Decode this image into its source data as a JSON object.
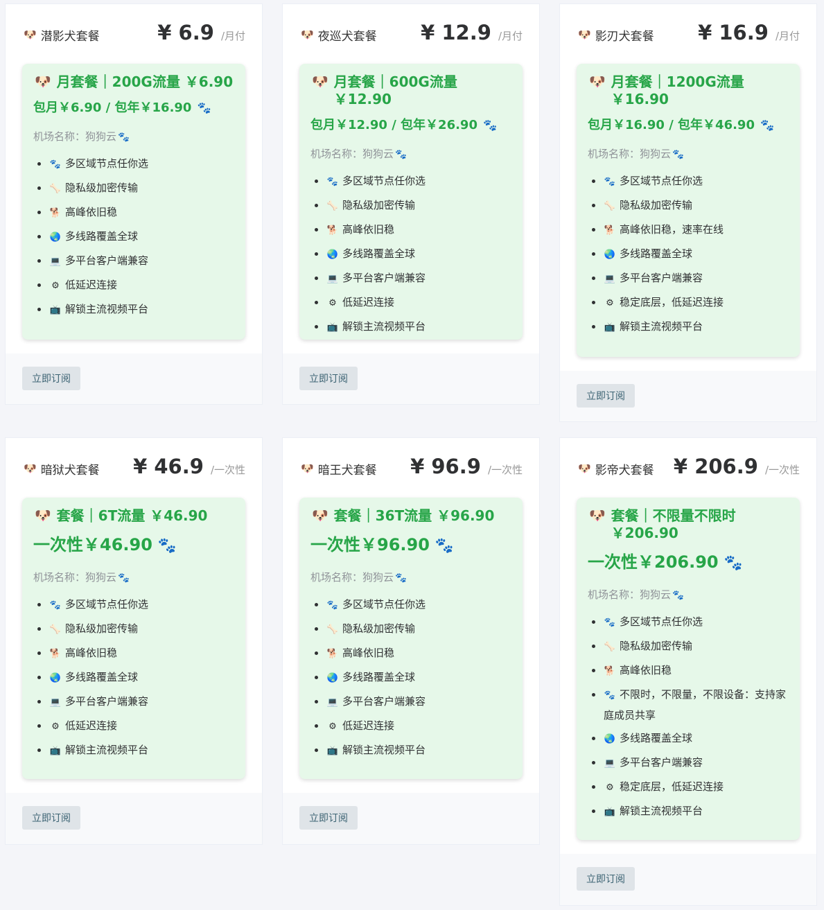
{
  "subscribe_label": "立即订阅",
  "airport_label": "机场名称：狗狗云",
  "cards": [
    {
      "title": "潜影犬套餐",
      "price": "¥ 6.9",
      "unit": "/月付",
      "inner_title": "月套餐｜200G流量 ￥6.90",
      "price_line": "包月￥6.90 / 包年￥16.90",
      "features": [
        "多区域节点任你选",
        "隐私级加密传输",
        "高峰依旧稳",
        "多线路覆盖全球",
        "多平台客户端兼容",
        "低延迟连接",
        "解锁主流视频平台"
      ]
    },
    {
      "title": "夜巡犬套餐",
      "price": "¥ 12.9",
      "unit": "/月付",
      "inner_title": "月套餐｜600G流量 ￥12.90",
      "price_line": "包月￥12.90 / 包年￥26.90",
      "features": [
        "多区域节点任你选",
        "隐私级加密传输",
        "高峰依旧稳",
        "多线路覆盖全球",
        "多平台客户端兼容",
        "低延迟连接",
        "解锁主流视频平台"
      ]
    },
    {
      "title": "影刃犬套餐",
      "price": "¥ 16.9",
      "unit": "/月付",
      "inner_title": "月套餐｜1200G流量 ￥16.90",
      "price_line": "包月￥16.90 / 包年￥46.90",
      "features": [
        "多区域节点任你选",
        "隐私级加密传输",
        "高峰依旧稳，速率在线",
        "多线路覆盖全球",
        "多平台客户端兼容",
        "稳定底层，低延迟连接",
        "解锁主流视频平台"
      ]
    },
    {
      "title": "暗狱犬套餐",
      "price": "¥ 46.9",
      "unit": "/一次性",
      "inner_title": "套餐｜6T流量 ￥46.90",
      "price_line": "一次性￥46.90",
      "features": [
        "多区域节点任你选",
        "隐私级加密传输",
        "高峰依旧稳",
        "多线路覆盖全球",
        "多平台客户端兼容",
        "低延迟连接",
        "解锁主流视频平台"
      ]
    },
    {
      "title": "暗王犬套餐",
      "price": "¥ 96.9",
      "unit": "/一次性",
      "inner_title": "套餐｜36T流量 ￥96.90",
      "price_line": "一次性￥96.90",
      "features": [
        "多区域节点任你选",
        "隐私级加密传输",
        "高峰依旧稳",
        "多线路覆盖全球",
        "多平台客户端兼容",
        "低延迟连接",
        "解锁主流视频平台"
      ]
    },
    {
      "title": "影帝犬套餐",
      "price": "¥ 206.9",
      "unit": "/一次性",
      "inner_title": "套餐｜不限量不限时 ￥206.90",
      "price_line": "一次性￥206.90",
      "features": [
        "多区域节点任你选",
        "隐私级加密传输",
        "高峰依旧稳",
        "不限时，不限量，不限设备：支持家庭成员共享",
        "多线路覆盖全球",
        "多平台客户端兼容",
        "稳定底层，低延迟连接",
        "解锁主流视频平台"
      ]
    }
  ]
}
